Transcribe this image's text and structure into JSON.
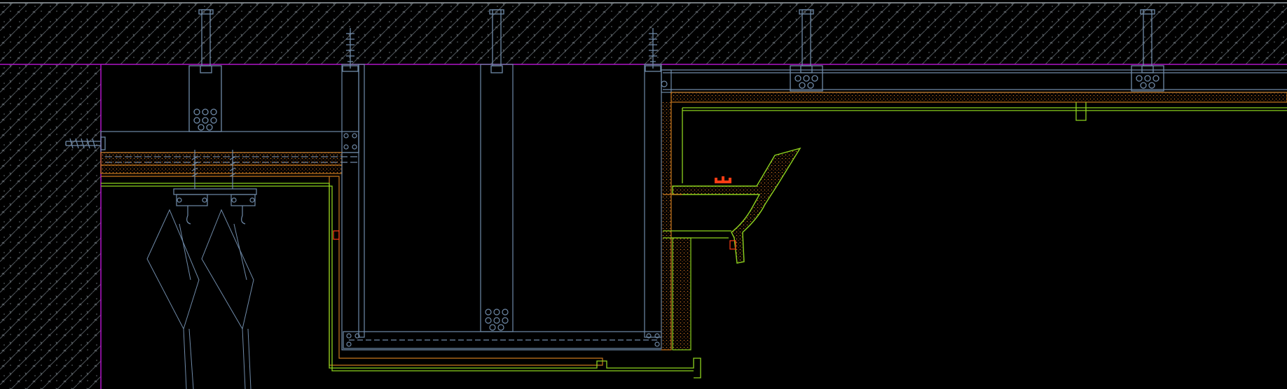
{
  "drawing": {
    "type": "cad-ceiling-section-detail",
    "background": "#000000",
    "colors": {
      "concrete_outline": "#9aa3a8",
      "concrete_hatch": "#5f666b",
      "boundary_magenta": "#b014c8",
      "steel_blue": "#6f8aa8",
      "board_orange": "#c8781e",
      "finish_green": "#8cd21e",
      "accent_red": "#ff3c14",
      "dot_fill": "#c06a20"
    },
    "components": [
      "concrete-slab",
      "concrete-wall",
      "expansion-anchor",
      "plastic-anchor",
      "hanger-rod",
      "runner-channel",
      "gypsum-board-layer",
      "curtain-track",
      "curtain-fabric",
      "light-trough",
      "led-strip",
      "access-cover"
    ],
    "labels": []
  }
}
